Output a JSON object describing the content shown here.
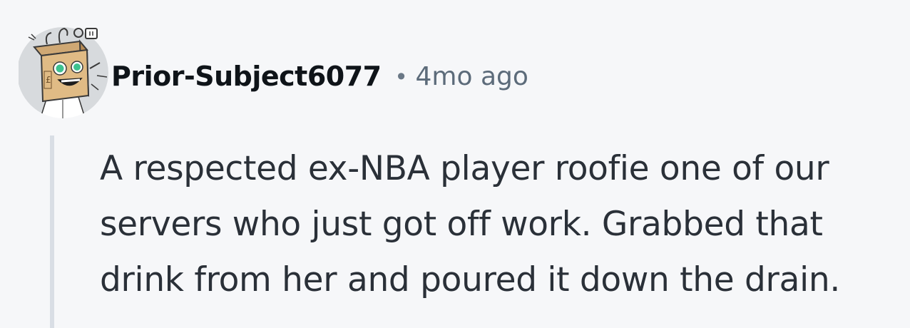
{
  "comment": {
    "author": "Prior-Subject6077",
    "separator": "•",
    "timestamp": "4mo ago",
    "body": "A respected ex-NBA player roofie one of our servers who just got off work. Grabbed that drink from her and poured it down the drain.",
    "avatar_icon": "robot-box-avatar-icon"
  },
  "colors": {
    "background": "#f6f7f9",
    "author": "#0f1419",
    "timestamp": "#5c6b7a",
    "body": "#2a3038",
    "thread_line": "#d9dee5",
    "avatar_bg": "#d7dadd"
  }
}
